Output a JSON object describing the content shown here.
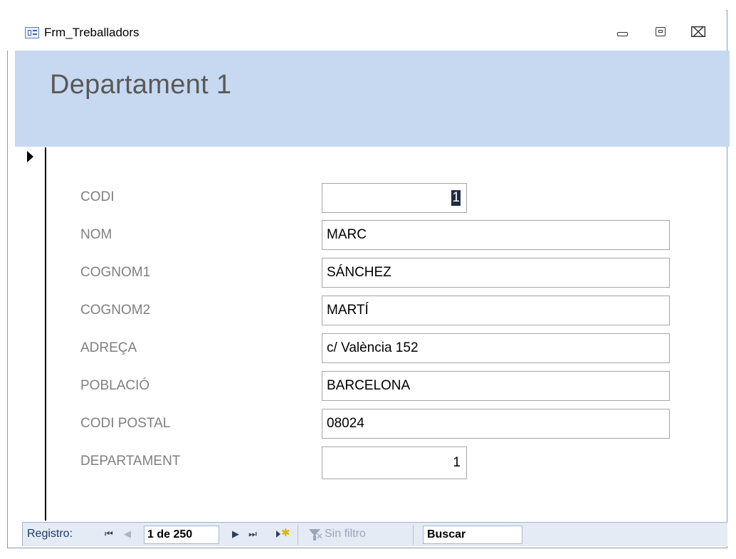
{
  "window": {
    "title": "Frm_Treballadors",
    "controls": {
      "minimize": "minimize",
      "maximize": "maximize",
      "close": "⌧"
    }
  },
  "header": {
    "title": "Departament 1"
  },
  "fields": [
    {
      "label": "CODI",
      "value": "1",
      "kind": "narrow"
    },
    {
      "label": "NOM",
      "value": "MARC",
      "kind": "wide"
    },
    {
      "label": "COGNOM1",
      "value": "SÁNCHEZ",
      "kind": "wide"
    },
    {
      "label": "COGNOM2",
      "value": "MARTÍ",
      "kind": "wide"
    },
    {
      "label": "ADREÇA",
      "value": "c/ València 152",
      "kind": "wide"
    },
    {
      "label": "POBLACIÓ",
      "value": "BARCELONA",
      "kind": "wide"
    },
    {
      "label": "CODI POSTAL",
      "value": "08024",
      "kind": "wide"
    },
    {
      "label": "DEPARTAMENT",
      "value": "1",
      "kind": "narrow"
    }
  ],
  "navigation": {
    "label": "Registro:",
    "first": "⏮",
    "previous": "◀",
    "record": "1 de 250",
    "next": "▶",
    "last": "⏭",
    "filter_label": "Sin filtro",
    "search_placeholder": "Buscar"
  },
  "colors": {
    "header_bg": "#c6d9f0",
    "nav_bg": "#e4ebf5",
    "label_text": "#7f7f7f"
  }
}
